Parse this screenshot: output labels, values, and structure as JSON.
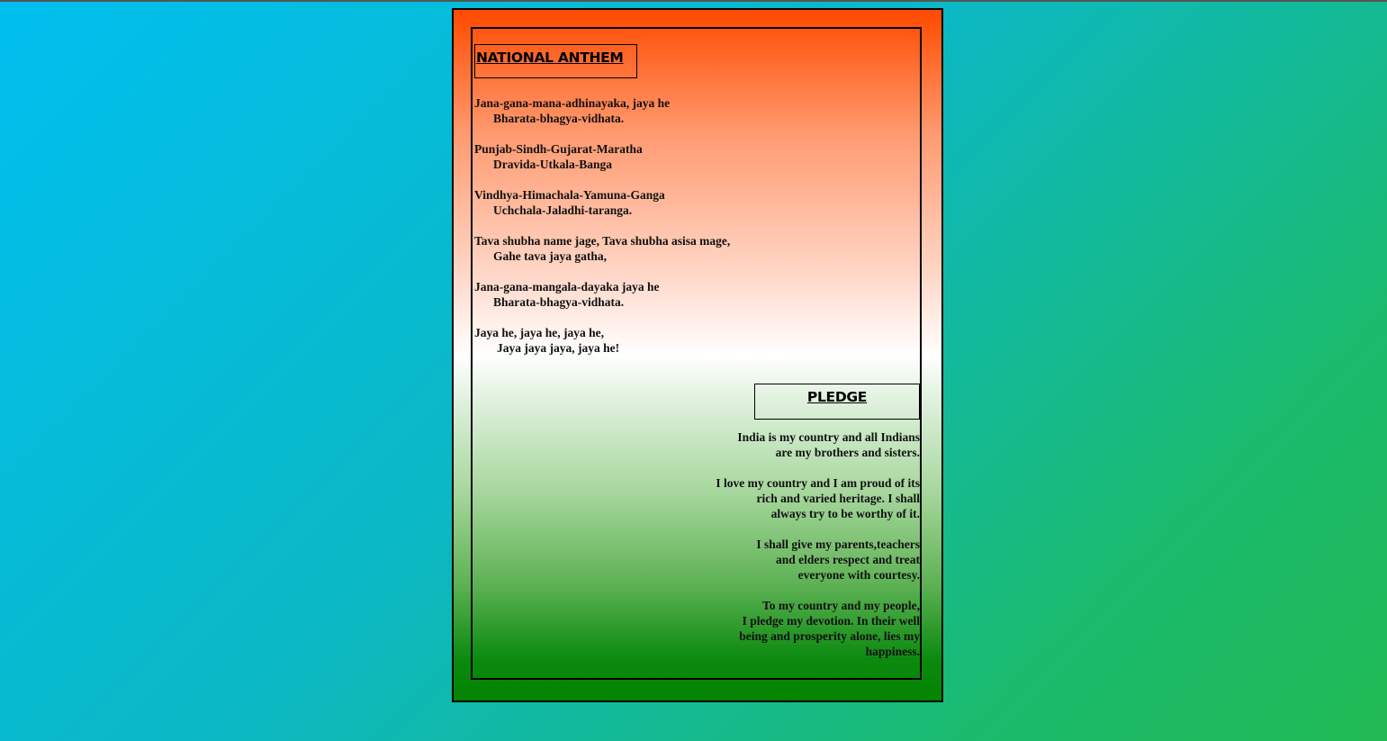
{
  "anthem": {
    "title": "NATIONAL ANTHEM",
    "stanzas": [
      {
        "l1": "Jana-gana-mana-adhinayaka, jaya he",
        "l2": "Bharata-bhagya-vidhata."
      },
      {
        "l1": "Punjab-Sindh-Gujarat-Maratha",
        "l2": "Dravida-Utkala-Banga"
      },
      {
        "l1": "Vindhya-Himachala-Yamuna-Ganga",
        "l2": "Uchchala-Jaladhi-taranga."
      },
      {
        "l1": "Tava shubha name jage, Tava shubha asisa mage,",
        "l2": "Gahe tava jaya gatha,"
      },
      {
        "l1": "Jana-gana-mangala-dayaka jaya he",
        "l2": "Bharata-bhagya-vidhata."
      },
      {
        "l1": "Jaya he, jaya he, jaya he,",
        "l2": "Jaya jaya jaya, jaya he!"
      }
    ]
  },
  "pledge": {
    "title": "PLEDGE",
    "paragraphs": [
      [
        "India is my country and all Indians",
        "are my brothers and sisters."
      ],
      [
        "I love my country and I am proud of its",
        "rich and varied heritage. I shall",
        "always try to be worthy of it."
      ],
      [
        "I shall give my parents,teachers",
        "and elders respect and treat",
        "everyone with courtesy."
      ],
      [
        "To my country and my people,",
        "I pledge my devotion. In their well",
        "being and prosperity alone, lies my",
        "happiness."
      ]
    ]
  },
  "colors": {
    "saffron": "#ff4a00",
    "white": "#ffffff",
    "green": "#048300",
    "background_start": "#00bfef",
    "background_end": "#22bb55"
  }
}
